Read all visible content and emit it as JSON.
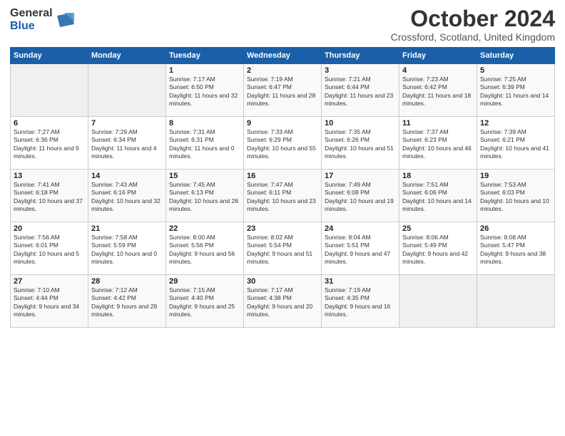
{
  "logo": {
    "general": "General",
    "blue": "Blue"
  },
  "header": {
    "month": "October 2024",
    "location": "Crossford, Scotland, United Kingdom"
  },
  "weekdays": [
    "Sunday",
    "Monday",
    "Tuesday",
    "Wednesday",
    "Thursday",
    "Friday",
    "Saturday"
  ],
  "weeks": [
    [
      {
        "day": "",
        "sunrise": "",
        "sunset": "",
        "daylight": ""
      },
      {
        "day": "",
        "sunrise": "",
        "sunset": "",
        "daylight": ""
      },
      {
        "day": "1",
        "sunrise": "Sunrise: 7:17 AM",
        "sunset": "Sunset: 6:50 PM",
        "daylight": "Daylight: 11 hours and 32 minutes."
      },
      {
        "day": "2",
        "sunrise": "Sunrise: 7:19 AM",
        "sunset": "Sunset: 6:47 PM",
        "daylight": "Daylight: 11 hours and 28 minutes."
      },
      {
        "day": "3",
        "sunrise": "Sunrise: 7:21 AM",
        "sunset": "Sunset: 6:44 PM",
        "daylight": "Daylight: 11 hours and 23 minutes."
      },
      {
        "day": "4",
        "sunrise": "Sunrise: 7:23 AM",
        "sunset": "Sunset: 6:42 PM",
        "daylight": "Daylight: 11 hours and 18 minutes."
      },
      {
        "day": "5",
        "sunrise": "Sunrise: 7:25 AM",
        "sunset": "Sunset: 6:39 PM",
        "daylight": "Daylight: 11 hours and 14 minutes."
      }
    ],
    [
      {
        "day": "6",
        "sunrise": "Sunrise: 7:27 AM",
        "sunset": "Sunset: 6:36 PM",
        "daylight": "Daylight: 11 hours and 9 minutes."
      },
      {
        "day": "7",
        "sunrise": "Sunrise: 7:29 AM",
        "sunset": "Sunset: 6:34 PM",
        "daylight": "Daylight: 11 hours and 4 minutes."
      },
      {
        "day": "8",
        "sunrise": "Sunrise: 7:31 AM",
        "sunset": "Sunset: 6:31 PM",
        "daylight": "Daylight: 11 hours and 0 minutes."
      },
      {
        "day": "9",
        "sunrise": "Sunrise: 7:33 AM",
        "sunset": "Sunset: 6:29 PM",
        "daylight": "Daylight: 10 hours and 55 minutes."
      },
      {
        "day": "10",
        "sunrise": "Sunrise: 7:35 AM",
        "sunset": "Sunset: 6:26 PM",
        "daylight": "Daylight: 10 hours and 51 minutes."
      },
      {
        "day": "11",
        "sunrise": "Sunrise: 7:37 AM",
        "sunset": "Sunset: 6:23 PM",
        "daylight": "Daylight: 10 hours and 46 minutes."
      },
      {
        "day": "12",
        "sunrise": "Sunrise: 7:39 AM",
        "sunset": "Sunset: 6:21 PM",
        "daylight": "Daylight: 10 hours and 41 minutes."
      }
    ],
    [
      {
        "day": "13",
        "sunrise": "Sunrise: 7:41 AM",
        "sunset": "Sunset: 6:18 PM",
        "daylight": "Daylight: 10 hours and 37 minutes."
      },
      {
        "day": "14",
        "sunrise": "Sunrise: 7:43 AM",
        "sunset": "Sunset: 6:16 PM",
        "daylight": "Daylight: 10 hours and 32 minutes."
      },
      {
        "day": "15",
        "sunrise": "Sunrise: 7:45 AM",
        "sunset": "Sunset: 6:13 PM",
        "daylight": "Daylight: 10 hours and 28 minutes."
      },
      {
        "day": "16",
        "sunrise": "Sunrise: 7:47 AM",
        "sunset": "Sunset: 6:11 PM",
        "daylight": "Daylight: 10 hours and 23 minutes."
      },
      {
        "day": "17",
        "sunrise": "Sunrise: 7:49 AM",
        "sunset": "Sunset: 6:08 PM",
        "daylight": "Daylight: 10 hours and 19 minutes."
      },
      {
        "day": "18",
        "sunrise": "Sunrise: 7:51 AM",
        "sunset": "Sunset: 6:06 PM",
        "daylight": "Daylight: 10 hours and 14 minutes."
      },
      {
        "day": "19",
        "sunrise": "Sunrise: 7:53 AM",
        "sunset": "Sunset: 6:03 PM",
        "daylight": "Daylight: 10 hours and 10 minutes."
      }
    ],
    [
      {
        "day": "20",
        "sunrise": "Sunrise: 7:56 AM",
        "sunset": "Sunset: 6:01 PM",
        "daylight": "Daylight: 10 hours and 5 minutes."
      },
      {
        "day": "21",
        "sunrise": "Sunrise: 7:58 AM",
        "sunset": "Sunset: 5:59 PM",
        "daylight": "Daylight: 10 hours and 0 minutes."
      },
      {
        "day": "22",
        "sunrise": "Sunrise: 8:00 AM",
        "sunset": "Sunset: 5:56 PM",
        "daylight": "Daylight: 9 hours and 56 minutes."
      },
      {
        "day": "23",
        "sunrise": "Sunrise: 8:02 AM",
        "sunset": "Sunset: 5:54 PM",
        "daylight": "Daylight: 9 hours and 51 minutes."
      },
      {
        "day": "24",
        "sunrise": "Sunrise: 8:04 AM",
        "sunset": "Sunset: 5:51 PM",
        "daylight": "Daylight: 9 hours and 47 minutes."
      },
      {
        "day": "25",
        "sunrise": "Sunrise: 8:06 AM",
        "sunset": "Sunset: 5:49 PM",
        "daylight": "Daylight: 9 hours and 42 minutes."
      },
      {
        "day": "26",
        "sunrise": "Sunrise: 8:08 AM",
        "sunset": "Sunset: 5:47 PM",
        "daylight": "Daylight: 9 hours and 38 minutes."
      }
    ],
    [
      {
        "day": "27",
        "sunrise": "Sunrise: 7:10 AM",
        "sunset": "Sunset: 4:44 PM",
        "daylight": "Daylight: 9 hours and 34 minutes."
      },
      {
        "day": "28",
        "sunrise": "Sunrise: 7:12 AM",
        "sunset": "Sunset: 4:42 PM",
        "daylight": "Daylight: 9 hours and 29 minutes."
      },
      {
        "day": "29",
        "sunrise": "Sunrise: 7:15 AM",
        "sunset": "Sunset: 4:40 PM",
        "daylight": "Daylight: 9 hours and 25 minutes."
      },
      {
        "day": "30",
        "sunrise": "Sunrise: 7:17 AM",
        "sunset": "Sunset: 4:38 PM",
        "daylight": "Daylight: 9 hours and 20 minutes."
      },
      {
        "day": "31",
        "sunrise": "Sunrise: 7:19 AM",
        "sunset": "Sunset: 4:35 PM",
        "daylight": "Daylight: 9 hours and 16 minutes."
      },
      {
        "day": "",
        "sunrise": "",
        "sunset": "",
        "daylight": ""
      },
      {
        "day": "",
        "sunrise": "",
        "sunset": "",
        "daylight": ""
      }
    ]
  ]
}
